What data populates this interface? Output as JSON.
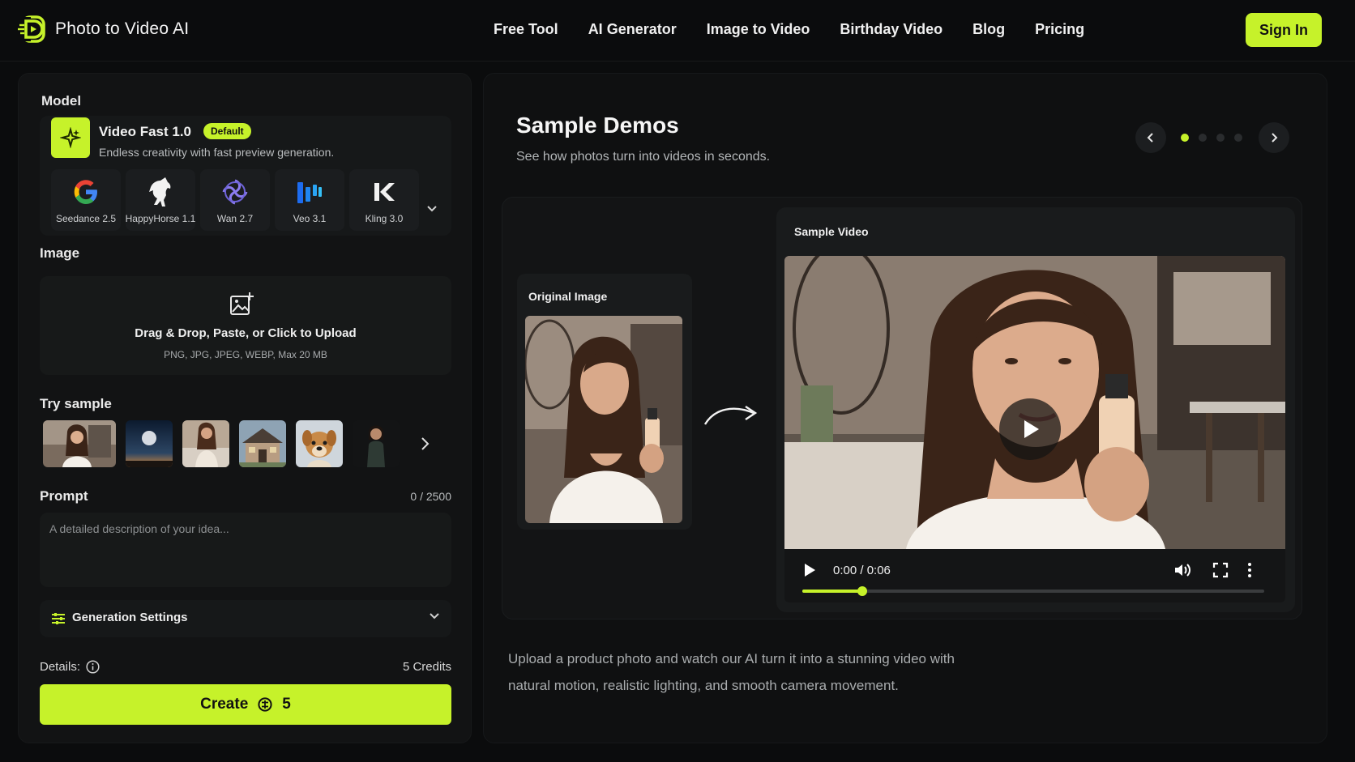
{
  "app": {
    "logo_text": "Photo to Video AI"
  },
  "nav": {
    "items": [
      "Free Tool",
      "AI Generator",
      "Image to Video",
      "Birthday Video",
      "Blog",
      "Pricing"
    ],
    "sign_in": "Sign In"
  },
  "colors": {
    "accent": "#c6f22a",
    "background": "#0b0c0d",
    "panel": "#121314"
  },
  "model": {
    "section_label": "Model",
    "name": "Video Fast 1.0",
    "badge": "Default",
    "description": "Endless creativity with fast preview generation.",
    "providers": [
      {
        "label": "Seedance 2.5",
        "icon": "google-g-icon"
      },
      {
        "label": "HappyHorse 1.1",
        "icon": "horse-icon"
      },
      {
        "label": "Wan 2.7",
        "icon": "wan-swirl-icon"
      },
      {
        "label": "Veo 3.1",
        "icon": "veo-bars-icon"
      },
      {
        "label": "Kling 3.0",
        "icon": "kling-k-icon"
      }
    ]
  },
  "image": {
    "section_label": "Image",
    "upload_title": "Drag & Drop, Paste, or Click to Upload",
    "upload_sub": "PNG, JPG, JPEG, WEBP, Max 20 MB"
  },
  "try_sample": {
    "section_label": "Try sample"
  },
  "prompt": {
    "section_label": "Prompt",
    "counter": "0 / 2500",
    "placeholder": "A detailed description of your idea..."
  },
  "generation_settings": {
    "label": "Generation Settings"
  },
  "details": {
    "label": "Details:",
    "credits": "5 Credits"
  },
  "create": {
    "label": "Create",
    "cost": "5"
  },
  "demo": {
    "title": "Sample Demos",
    "subtitle": "See how photos turn into videos in seconds.",
    "carousel_total": 4,
    "carousel_active": 0,
    "original_label": "Original Image",
    "video_label": "Sample Video",
    "time": "0:00 / 0:06",
    "progress": 0.13,
    "description": "Upload a product photo and watch our AI turn it into a stunning video with natural motion, realistic lighting, and smooth camera movement."
  }
}
